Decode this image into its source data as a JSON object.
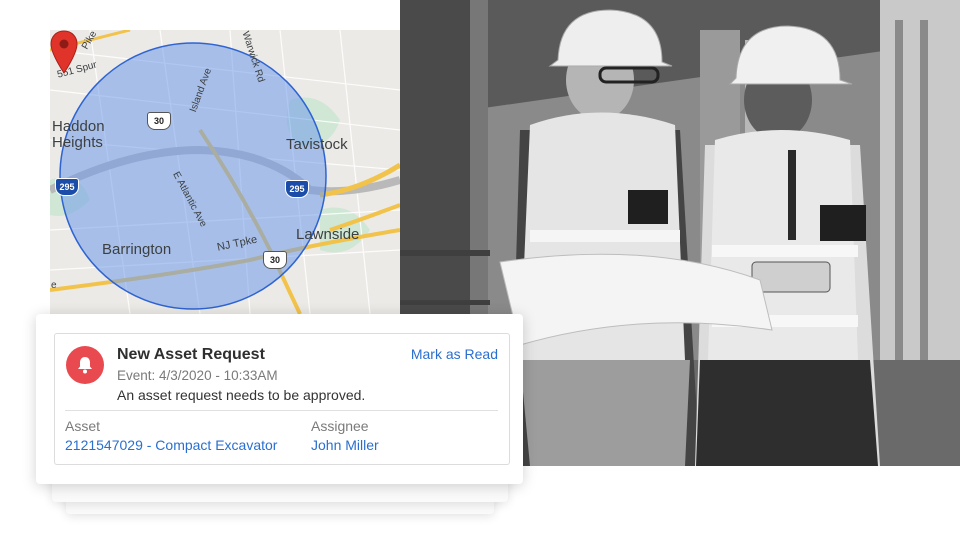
{
  "map": {
    "labels": {
      "haddon_heights_1": "Haddon",
      "haddon_heights_2": "Heights",
      "tavistock": "Tavistock",
      "barrington": "Barrington",
      "lawnside": "Lawnside",
      "nj_tpke": "NJ Tpke",
      "e_atlantic_ave": "E Atlantic Ave",
      "island_ave": "Island Ave",
      "spur_551": "551 Spur",
      "warwick_rd": "Warwick Rd",
      "pike": "Pike",
      "edge_e": "e"
    },
    "shields": {
      "us30_top": "30",
      "us30_bottom": "30",
      "i295_left": "295",
      "i295_right": "295"
    },
    "colors": {
      "geofence_fill": "#6f9be9",
      "geofence_stroke": "#2e63d2",
      "pin": "#e0342a"
    }
  },
  "notification": {
    "title": "New Asset Request",
    "event": "Event: 4/3/2020 - 10:33AM",
    "message": "An asset request needs to be approved.",
    "mark_read_label": "Mark as Read",
    "asset_label": "Asset",
    "asset_value": "2121547029 - Compact Excavator",
    "assignee_label": "Assignee",
    "assignee_value": "John Miller",
    "bell_icon": "bell-icon",
    "colors": {
      "accent": "#e94a4f",
      "link": "#2a6fcf"
    }
  }
}
